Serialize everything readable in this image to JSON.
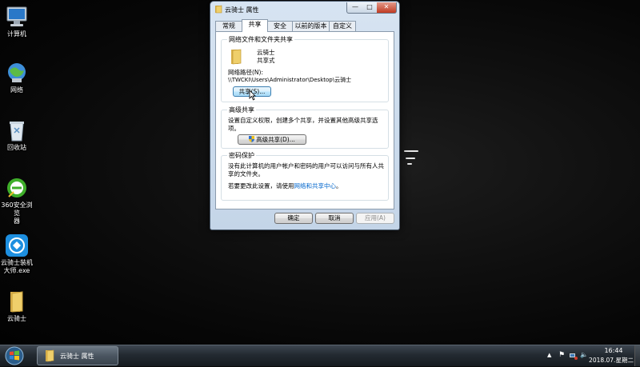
{
  "desktop": {
    "icons": [
      {
        "label": "计算机",
        "icon": "computer-icon"
      },
      {
        "label": "网络",
        "icon": "network-icon"
      },
      {
        "label": "回收站",
        "icon": "recycle-bin-icon"
      },
      {
        "label": "360安全浏览\n器",
        "icon": "browser-360-icon"
      },
      {
        "label": "云骑士装机\n大师.exe",
        "icon": "yunqishi-installer-icon"
      },
      {
        "label": "云骑士",
        "icon": "folder-icon"
      }
    ]
  },
  "dialog": {
    "title": "云骑士 属性",
    "caption_buttons": {
      "min": "—",
      "max": "□",
      "close": "✕"
    },
    "tabs": [
      "常规",
      "共享",
      "安全",
      "以前的版本",
      "自定义"
    ],
    "active_tab": "共享",
    "network_share": {
      "heading": "网络文件和文件夹共享",
      "folder_name": "云骑士",
      "share_state": "共享式",
      "path_label": "网络路径(N):",
      "path_value": "\\\\TWCKI\\Users\\Administrator\\Desktop\\云骑士",
      "share_button": "共享(S)..."
    },
    "advanced_share": {
      "heading": "高级共享",
      "description": "设置自定义权限，创建多个共享，并设置其他高级共享选项。",
      "button": "高级共享(D)..."
    },
    "password": {
      "heading": "密码保护",
      "description": "没有此计算机的用户帐户和密码的用户可以访问与所有人共享的文件夹。",
      "change_prefix": "若要更改此设置，请使用",
      "link": "网络和共享中心",
      "suffix": "。"
    },
    "buttons": {
      "ok": "确定",
      "cancel": "取消",
      "apply": "应用(A)"
    }
  },
  "taskbar": {
    "task_item": "云骑士 属性",
    "tray": {
      "chevron": "▲",
      "flag": "⚑",
      "volume": "🔈"
    },
    "time": "16:44",
    "date": "2018.07.星期二"
  },
  "colors": {
    "desktop": "#0a0a0a",
    "link": "#0066cc",
    "focus_border": "#3c7fb1",
    "folder": "#e7c25a"
  }
}
